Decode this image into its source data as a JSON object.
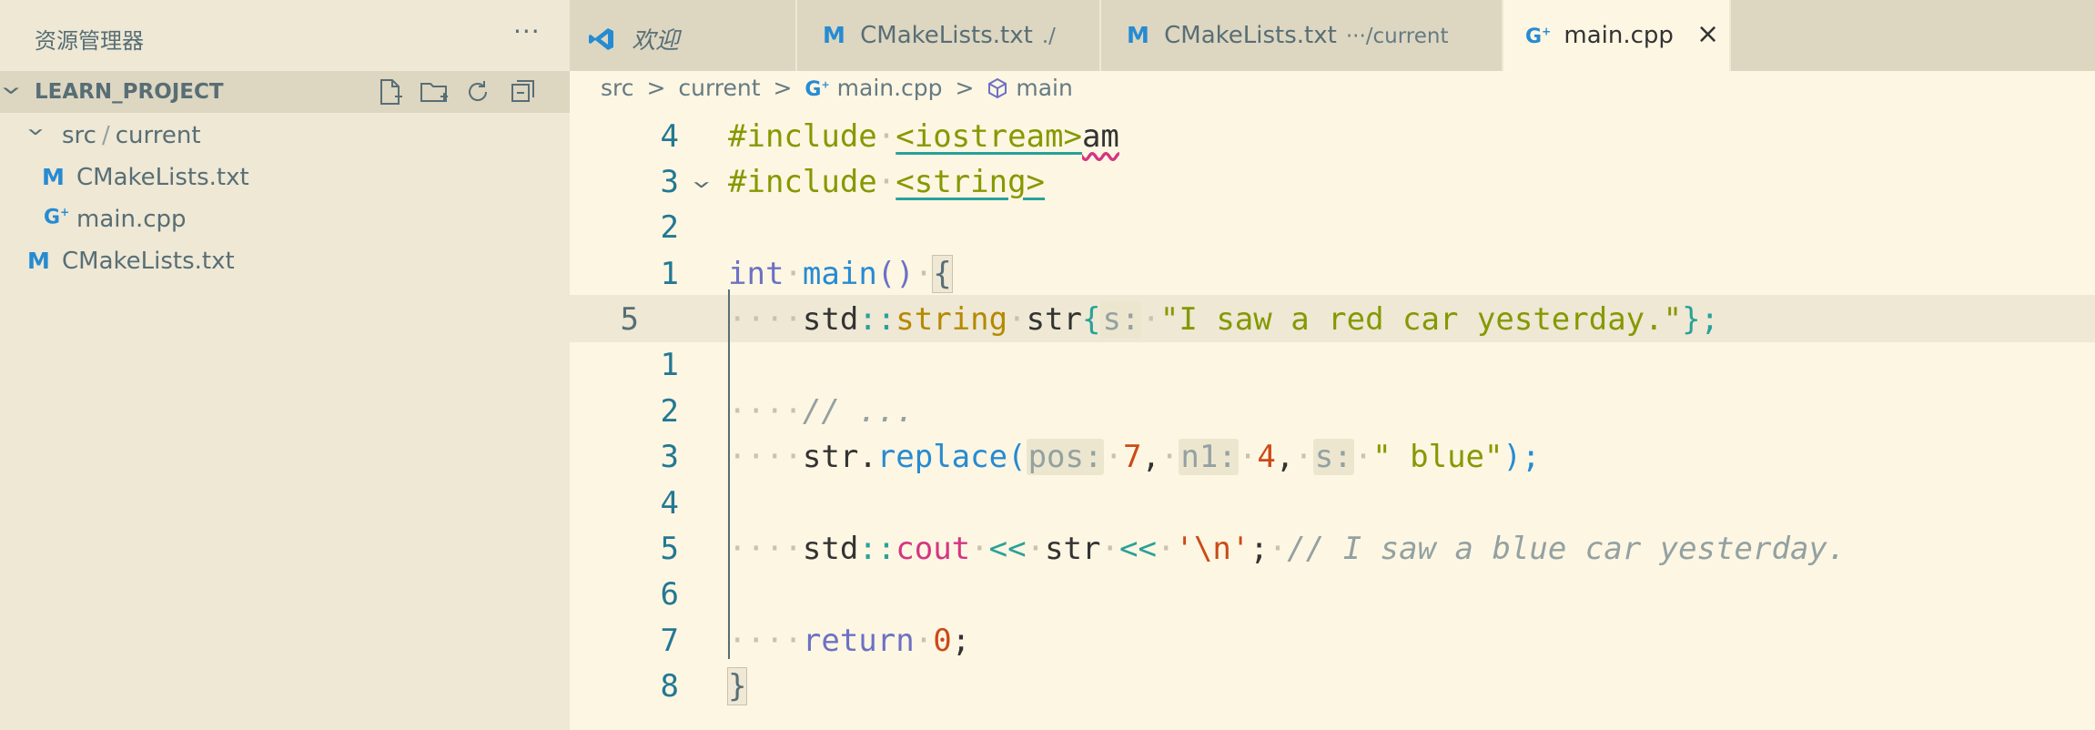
{
  "sidebar": {
    "title": "资源管理器",
    "more": "···",
    "section": "LEARN_PROJECT",
    "tree": [
      {
        "label_a": "src",
        "label_b": "current"
      },
      {
        "icon": "M",
        "label": "CMakeLists.txt"
      },
      {
        "icon": "G",
        "label": "main.cpp"
      },
      {
        "icon": "M",
        "label": "CMakeLists.txt"
      }
    ]
  },
  "tabs": [
    {
      "label": "欢迎"
    },
    {
      "icon": "M",
      "label": "CMakeLists.txt",
      "desc": "./"
    },
    {
      "icon": "M",
      "label": "CMakeLists.txt",
      "desc": "···/current"
    },
    {
      "icon": "G",
      "label": "main.cpp",
      "close": "×"
    }
  ],
  "breadcrumb": {
    "items": [
      "src",
      "current",
      "main.cpp",
      "main"
    ],
    "sep": ">"
  },
  "editor": {
    "line_numbers": [
      "4",
      "3",
      "2",
      "1",
      "5",
      "1",
      "2",
      "3",
      "4",
      "5",
      "6",
      "7",
      "8"
    ],
    "tokens": {
      "include": "#include",
      "iostream": "<iostream>",
      "typed": "am",
      "string_header": "<string>",
      "int": "int",
      "main": "main",
      "parens": "()",
      "open_brace": "{",
      "std": "std",
      "scope": "::",
      "string_type": "string",
      "str": "str",
      "hint_s": "s:",
      "sentence": "\"I saw a red car yesterday.\"",
      "semi_close": "};",
      "comment_dots": "// ...",
      "replace": "replace",
      "hint_pos": "pos:",
      "seven": "7",
      "hint_n1": "n1:",
      "four": "4",
      "blue_str": "\" blue\"",
      "close_paren_semi": ");",
      "cout": "cout",
      "shift": "<<",
      "newline_char": "'\\n'",
      "semi": ";",
      "output_comment": "// I saw a blue car yesterday.",
      "return": "return",
      "zero": "0",
      "close_brace": "}"
    }
  }
}
